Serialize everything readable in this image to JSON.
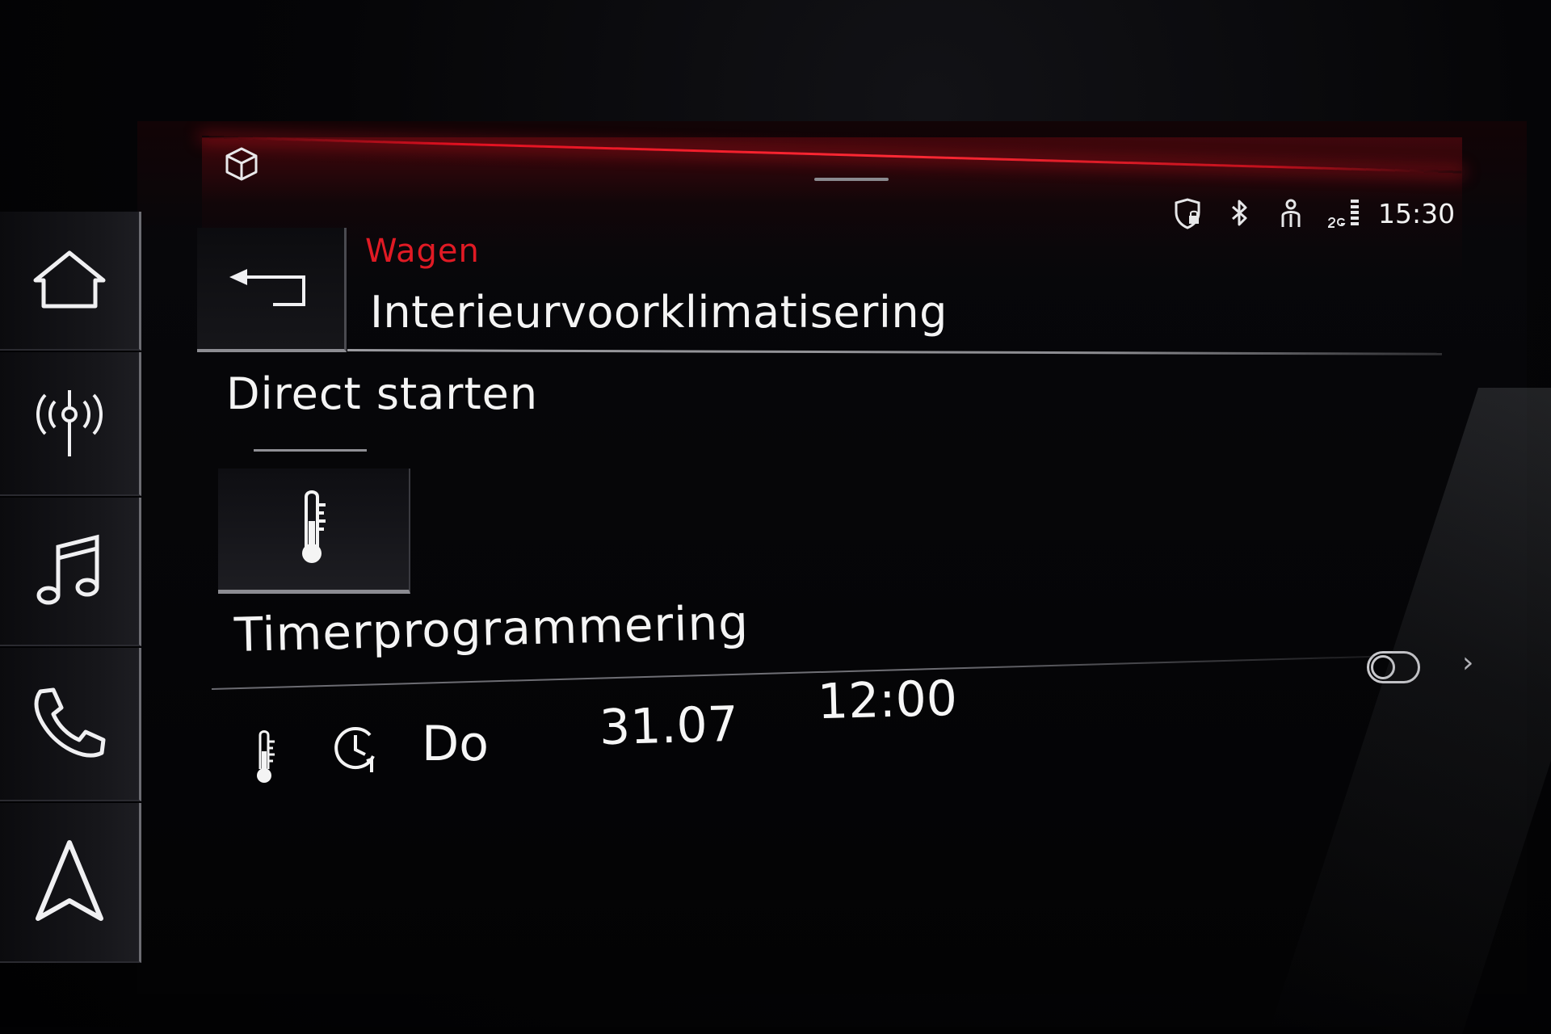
{
  "header": {
    "breadcrumb": "Wagen",
    "title": "Interieurvoorklimatisering"
  },
  "status_bar": {
    "time": "15:30",
    "icons": [
      "shield-lock-icon",
      "bluetooth-icon",
      "person-icon",
      "signal-2g-icon"
    ]
  },
  "sidebar": {
    "items": [
      {
        "name": "home",
        "icon": "home-icon"
      },
      {
        "name": "radio",
        "icon": "radio-antenna-icon"
      },
      {
        "name": "media",
        "icon": "music-note-icon"
      },
      {
        "name": "phone",
        "icon": "phone-icon"
      },
      {
        "name": "navigation",
        "icon": "navigation-arrow-icon"
      }
    ]
  },
  "sections": {
    "direct": {
      "label": "Direct starten",
      "tile_icon": "thermometer-icon"
    },
    "timer": {
      "label": "Timerprogrammering",
      "toggle_state": "off",
      "entry": {
        "day": "Do",
        "date": "31.07",
        "time": "12:00"
      }
    }
  },
  "colors": {
    "accent_red": "#e01a24",
    "text": "#f4f4f4",
    "background": "#050507"
  }
}
